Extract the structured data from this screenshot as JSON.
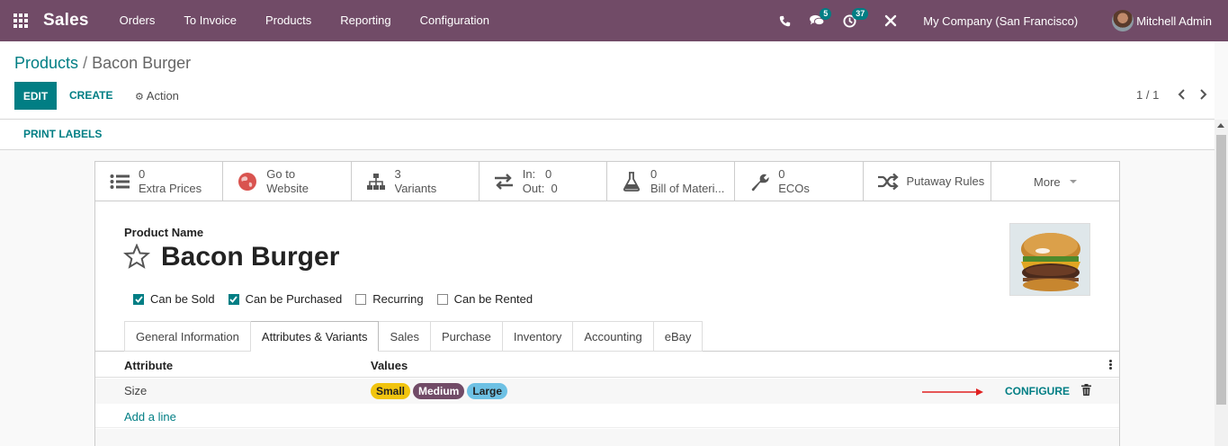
{
  "navbar": {
    "brand": "Sales",
    "menu": [
      "Orders",
      "To Invoice",
      "Products",
      "Reporting",
      "Configuration"
    ],
    "messages_count": "5",
    "activities_count": "37",
    "company": "My Company (San Francisco)",
    "user": "Mitchell Admin",
    "bg_color": "#714B67"
  },
  "control": {
    "breadcrumb_parent": "Products",
    "breadcrumb_sep": "/",
    "breadcrumb_current": "Bacon Burger",
    "edit_label": "EDIT",
    "create_label": "CREATE",
    "action_label": "Action",
    "pager": "1 / 1"
  },
  "statusbar": {
    "print_labels": "PRINT LABELS"
  },
  "smart_buttons": [
    {
      "icon": "list-icon",
      "value": "0",
      "label": "Extra Prices"
    },
    {
      "icon": "globe-icon",
      "value": "Go to",
      "label": "Website"
    },
    {
      "icon": "sitemap-icon",
      "value": "3",
      "label": "Variants"
    },
    {
      "icon": "exchange-icon",
      "value": "In:   0",
      "label": "Out:  0"
    },
    {
      "icon": "flask-icon",
      "value": "0",
      "label": "Bill of Materi..."
    },
    {
      "icon": "wrench-icon",
      "value": "0",
      "label": "ECOs"
    },
    {
      "icon": "random-icon",
      "value": "",
      "label": "Putaway Rules"
    },
    {
      "icon": "",
      "value": "",
      "label": "More"
    }
  ],
  "form": {
    "name_label": "Product Name",
    "name": "Bacon Burger",
    "checkboxes": [
      {
        "label": "Can be Sold",
        "checked": true
      },
      {
        "label": "Can be Purchased",
        "checked": true
      },
      {
        "label": "Recurring",
        "checked": false
      },
      {
        "label": "Can be Rented",
        "checked": false
      }
    ],
    "tabs": [
      "General Information",
      "Attributes & Variants",
      "Sales",
      "Purchase",
      "Inventory",
      "Accounting",
      "eBay"
    ],
    "active_tab": "Attributes & Variants"
  },
  "attributes_table": {
    "headers": {
      "attribute": "Attribute",
      "values": "Values"
    },
    "rows": [
      {
        "attribute": "Size",
        "values": [
          {
            "label": "Small",
            "bg": "#f1c40f",
            "fg": "#222222"
          },
          {
            "label": "Medium",
            "bg": "#714B67",
            "fg": "#ffffff"
          },
          {
            "label": "Large",
            "bg": "#6ec1e4",
            "fg": "#222222"
          }
        ],
        "action": "CONFIGURE"
      }
    ],
    "add_line": "Add a line"
  },
  "colors": {
    "accent": "#017e84",
    "arrow": "#e02020"
  }
}
